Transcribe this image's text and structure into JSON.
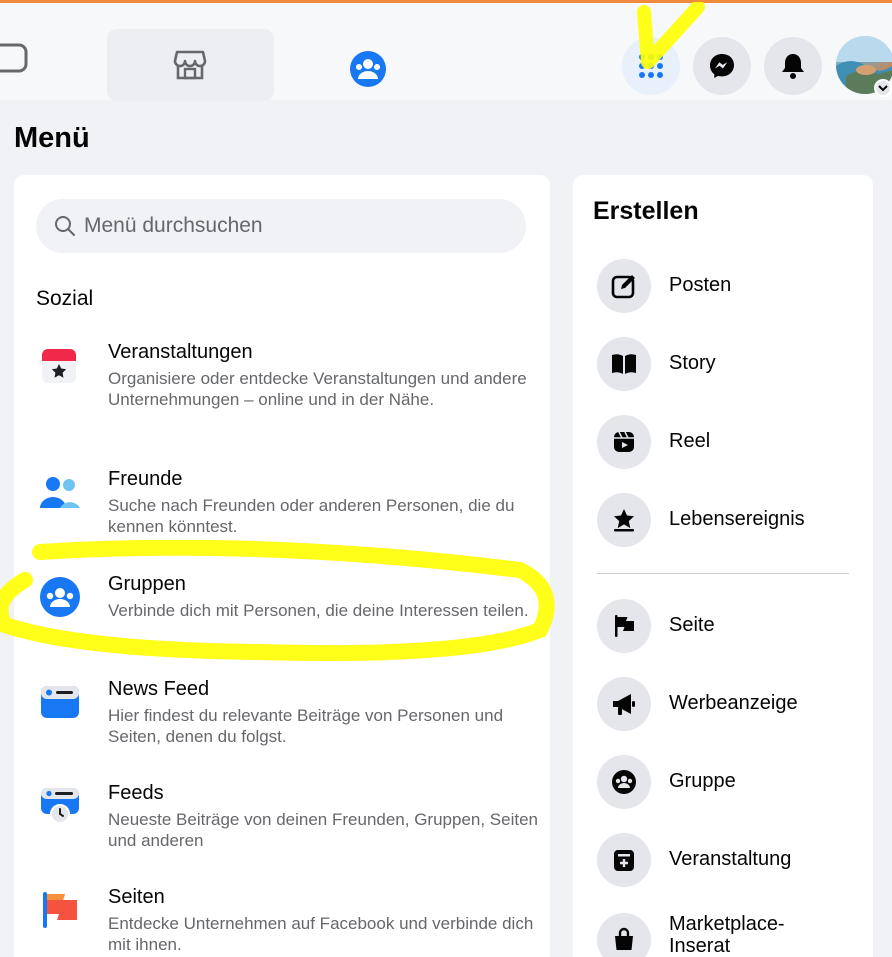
{
  "menu_title": "Menü",
  "search": {
    "placeholder": "Menü durchsuchen"
  },
  "social": {
    "heading": "Sozial",
    "items": [
      {
        "title": "Veranstaltungen",
        "desc": "Organisiere oder entdecke Veranstaltungen und andere Unternehmungen – online und in der Nähe.",
        "icon": "calendar-icon"
      },
      {
        "title": "Freunde",
        "desc": "Suche nach Freunden oder anderen Personen, die du kennen könntest.",
        "icon": "friends-icon"
      },
      {
        "title": "Gruppen",
        "desc": "Verbinde dich mit Personen, die deine Interessen teilen.",
        "icon": "groups-icon"
      },
      {
        "title": "News Feed",
        "desc": "Hier findest du relevante Beiträge von Personen und Seiten, denen du folgst.",
        "icon": "news-feed-icon"
      },
      {
        "title": "Feeds",
        "desc": "Neueste Beiträge von deinen Freunden, Gruppen, Seiten und anderen",
        "icon": "feeds-icon"
      },
      {
        "title": "Seiten",
        "desc": "Entdecke Unternehmen auf Facebook und verbinde dich mit ihnen.",
        "icon": "flag-icon"
      }
    ]
  },
  "create": {
    "heading": "Erstellen",
    "items": [
      {
        "label": "Posten",
        "icon": "compose-icon"
      },
      {
        "label": "Story",
        "icon": "book-icon"
      },
      {
        "label": "Reel",
        "icon": "reel-icon"
      },
      {
        "label": "Lebensereignis",
        "icon": "star-icon"
      },
      {
        "label": "Seite",
        "icon": "flag-icon"
      },
      {
        "label": "Werbeanzeige",
        "icon": "megaphone-icon"
      },
      {
        "label": "Gruppe",
        "icon": "group-icon"
      },
      {
        "label": "Veranstaltung",
        "icon": "event-icon"
      },
      {
        "label": "Marketplace-Inserat",
        "icon": "bag-icon"
      }
    ]
  },
  "colors": {
    "brand": "#1877f2",
    "highlight": "#ffff00",
    "top_accent": "#f08a3c"
  }
}
